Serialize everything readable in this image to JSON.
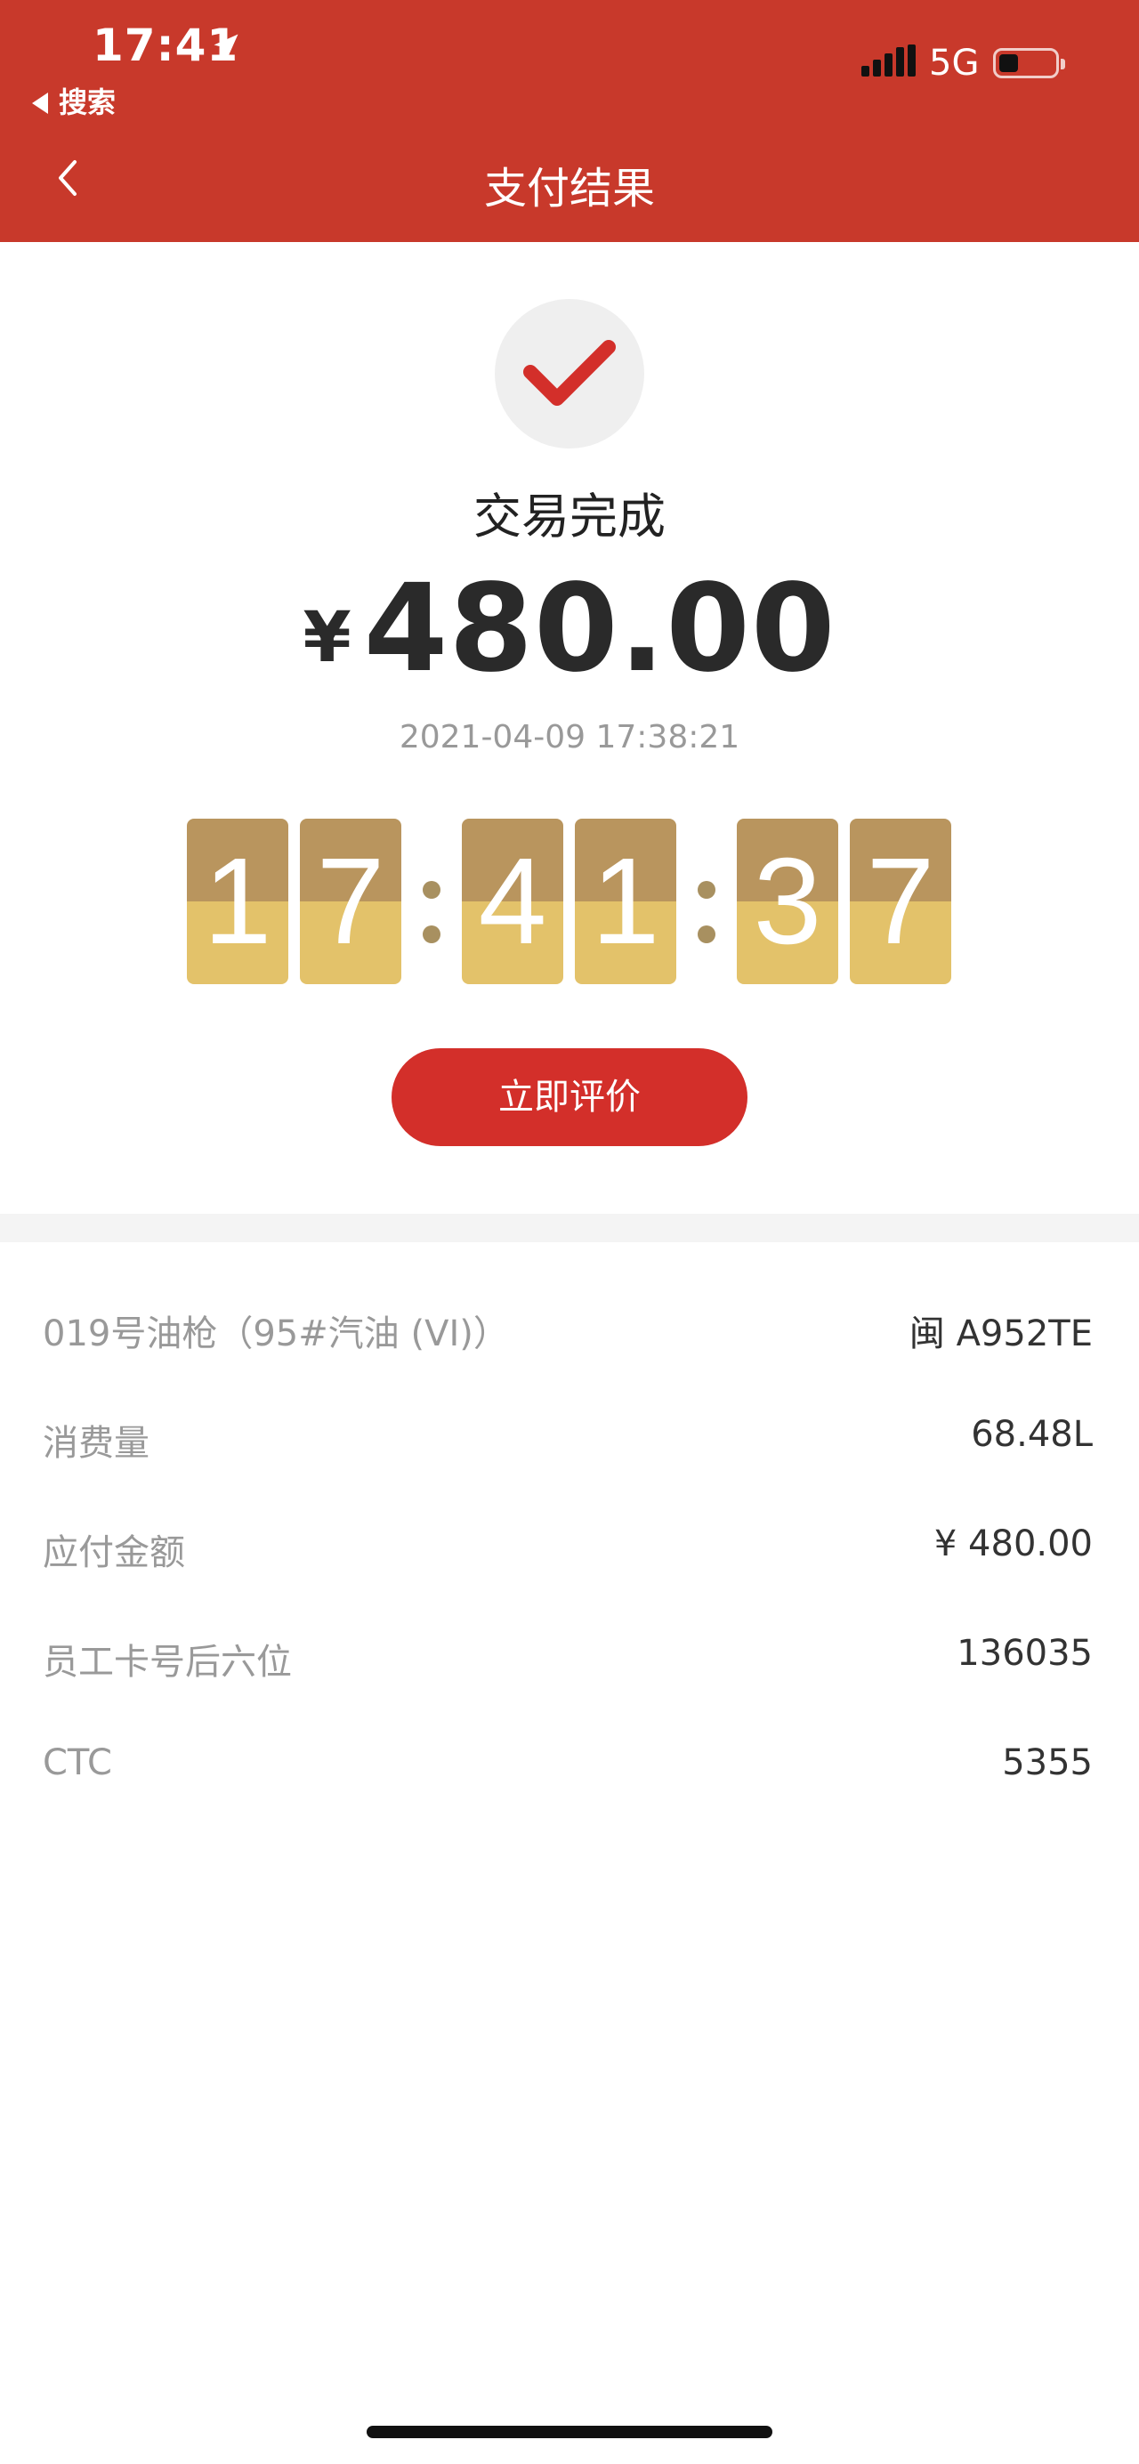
{
  "status_bar": {
    "time": "17:41",
    "back_app": "搜索",
    "network": "5G",
    "battery_level": 0.35,
    "location_icon": "location-arrow-icon",
    "signal_icon": "signal-bars-icon"
  },
  "nav": {
    "title": "支付结果",
    "back_icon": "chevron-left-icon"
  },
  "result": {
    "status_icon": "checkmark-icon",
    "status_text": "交易完成",
    "currency": "¥",
    "amount": "480.00",
    "datetime": "2021-04-09 17:38:21"
  },
  "clock": {
    "h1": "1",
    "h2": "7",
    "m1": "4",
    "m2": "1",
    "s1": "3",
    "s2": "7"
  },
  "actions": {
    "rate_label": "立即评价"
  },
  "details": [
    {
      "label": "019号油枪（95#汽油 (VI)）",
      "value": "闽 A952TE"
    },
    {
      "label": "消费量",
      "value": "68.48L"
    },
    {
      "label": "应付金额",
      "value": "¥ 480.00"
    },
    {
      "label": "员工卡号后六位",
      "value": "136035"
    },
    {
      "label": "CTC",
      "value": "5355"
    }
  ],
  "colors": {
    "header": "#c8392b",
    "accent": "#d32f2a",
    "flip_top": "#b9955e",
    "flip_bottom": "#e3c26a"
  }
}
